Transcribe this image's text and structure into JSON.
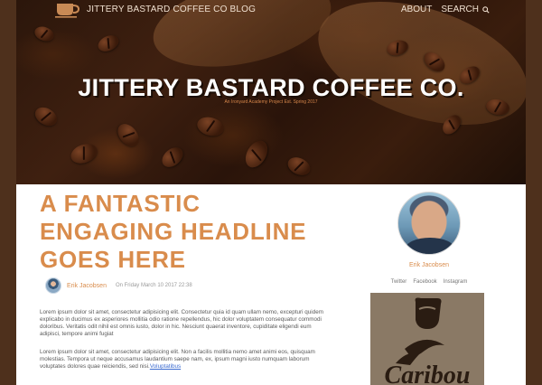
{
  "header": {
    "blog_title": "JITTERY BASTARD COFFEE CO BLOG",
    "nav_about": "ABOUT",
    "nav_search": "SEARCH"
  },
  "hero": {
    "title": "JITTERY BASTARD COFFEE CO.",
    "subtitle": "An Ironyard Academy Project Est. Spring 2017"
  },
  "post": {
    "headline": "A FANTASTIC ENGAGING HEADLINE GOES HERE",
    "author": "Erik Jacobsen",
    "date": "On Friday March 10 2017 22:38",
    "paragraph1": "Lorem ipsum dolor sit amet, consectetur adipisicing elit. Consectetur quia id quam ullam nemo, excepturi quidem explicabo in ducimus ex asperiores mollitia odio ratione repellendus, hic dolor voluptatem consequatur commodi doloribus. Veritatis odit nihil est omnis iusto, dolor in hic. Nesciunt quaerat inventore, cupiditate eligendi eum adipisci, tempore animi fugiat",
    "paragraph2": "Lorem ipsum dolor sit amet, consectetur adipisicing elit. Non a facilis mollitia nemo amet animi eos, quisquam molestias. Tempora ut neque accusamus laudantium saepe nam, ex, ipsum magni iusto numquam laborum voluptates dolores quae reiciendis, sed nisi.",
    "link_text": "Voluptatibus"
  },
  "sidebar": {
    "profile_name": "Erik Jacobsen",
    "social": [
      "Twitter",
      "Facebook",
      "Instagram"
    ],
    "promo_text": "Caribou"
  },
  "colors": {
    "accent": "#d98c4c",
    "frame": "#5a3822",
    "link": "#3a6ad0"
  }
}
